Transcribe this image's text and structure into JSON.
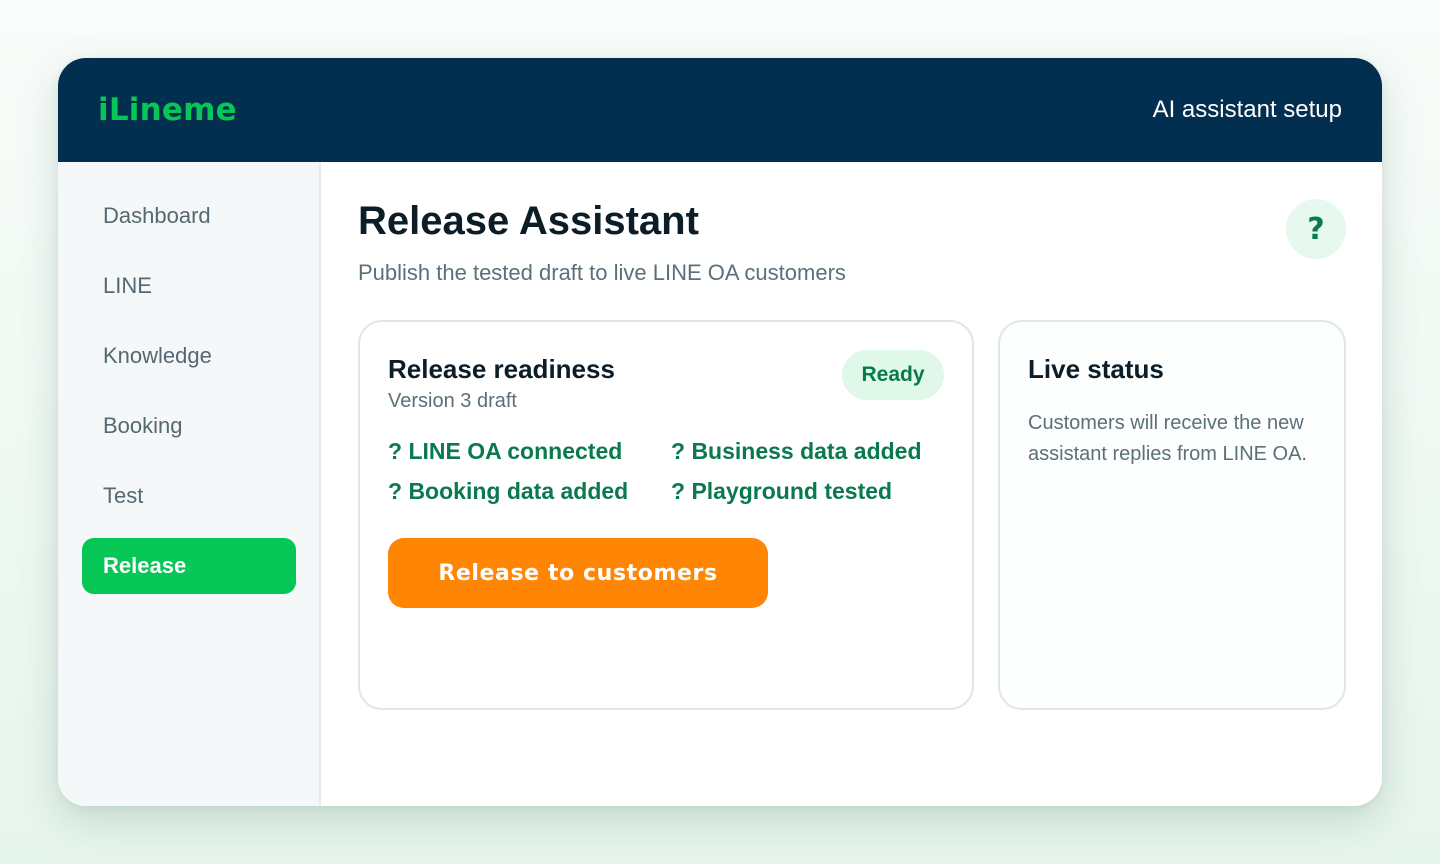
{
  "header": {
    "brand": "iLineme",
    "title": "AI assistant setup"
  },
  "sidebar": {
    "items": [
      {
        "label": "Dashboard",
        "active": false
      },
      {
        "label": "LINE",
        "active": false
      },
      {
        "label": "Knowledge",
        "active": false
      },
      {
        "label": "Booking",
        "active": false
      },
      {
        "label": "Test",
        "active": false
      },
      {
        "label": "Release",
        "active": true
      }
    ]
  },
  "main": {
    "title": "Release Assistant",
    "subtitle": "Publish the tested draft to live LINE OA customers",
    "help_label": "?"
  },
  "readiness": {
    "title": "Release readiness",
    "version": "Version 3 draft",
    "badge": "Ready",
    "checks": [
      "? LINE OA connected",
      "? Business data added",
      "? Booking data added",
      "? Playground tested"
    ],
    "release_button": "Release to customers"
  },
  "live_status": {
    "title": "Live status",
    "text": "Customers will receive the new assistant replies from LINE OA."
  },
  "colors": {
    "header_bg": "#022e4f",
    "brand": "#06c755",
    "active_nav": "#06c755",
    "release_button": "#ff8504",
    "check_text": "#0a7a4e"
  }
}
